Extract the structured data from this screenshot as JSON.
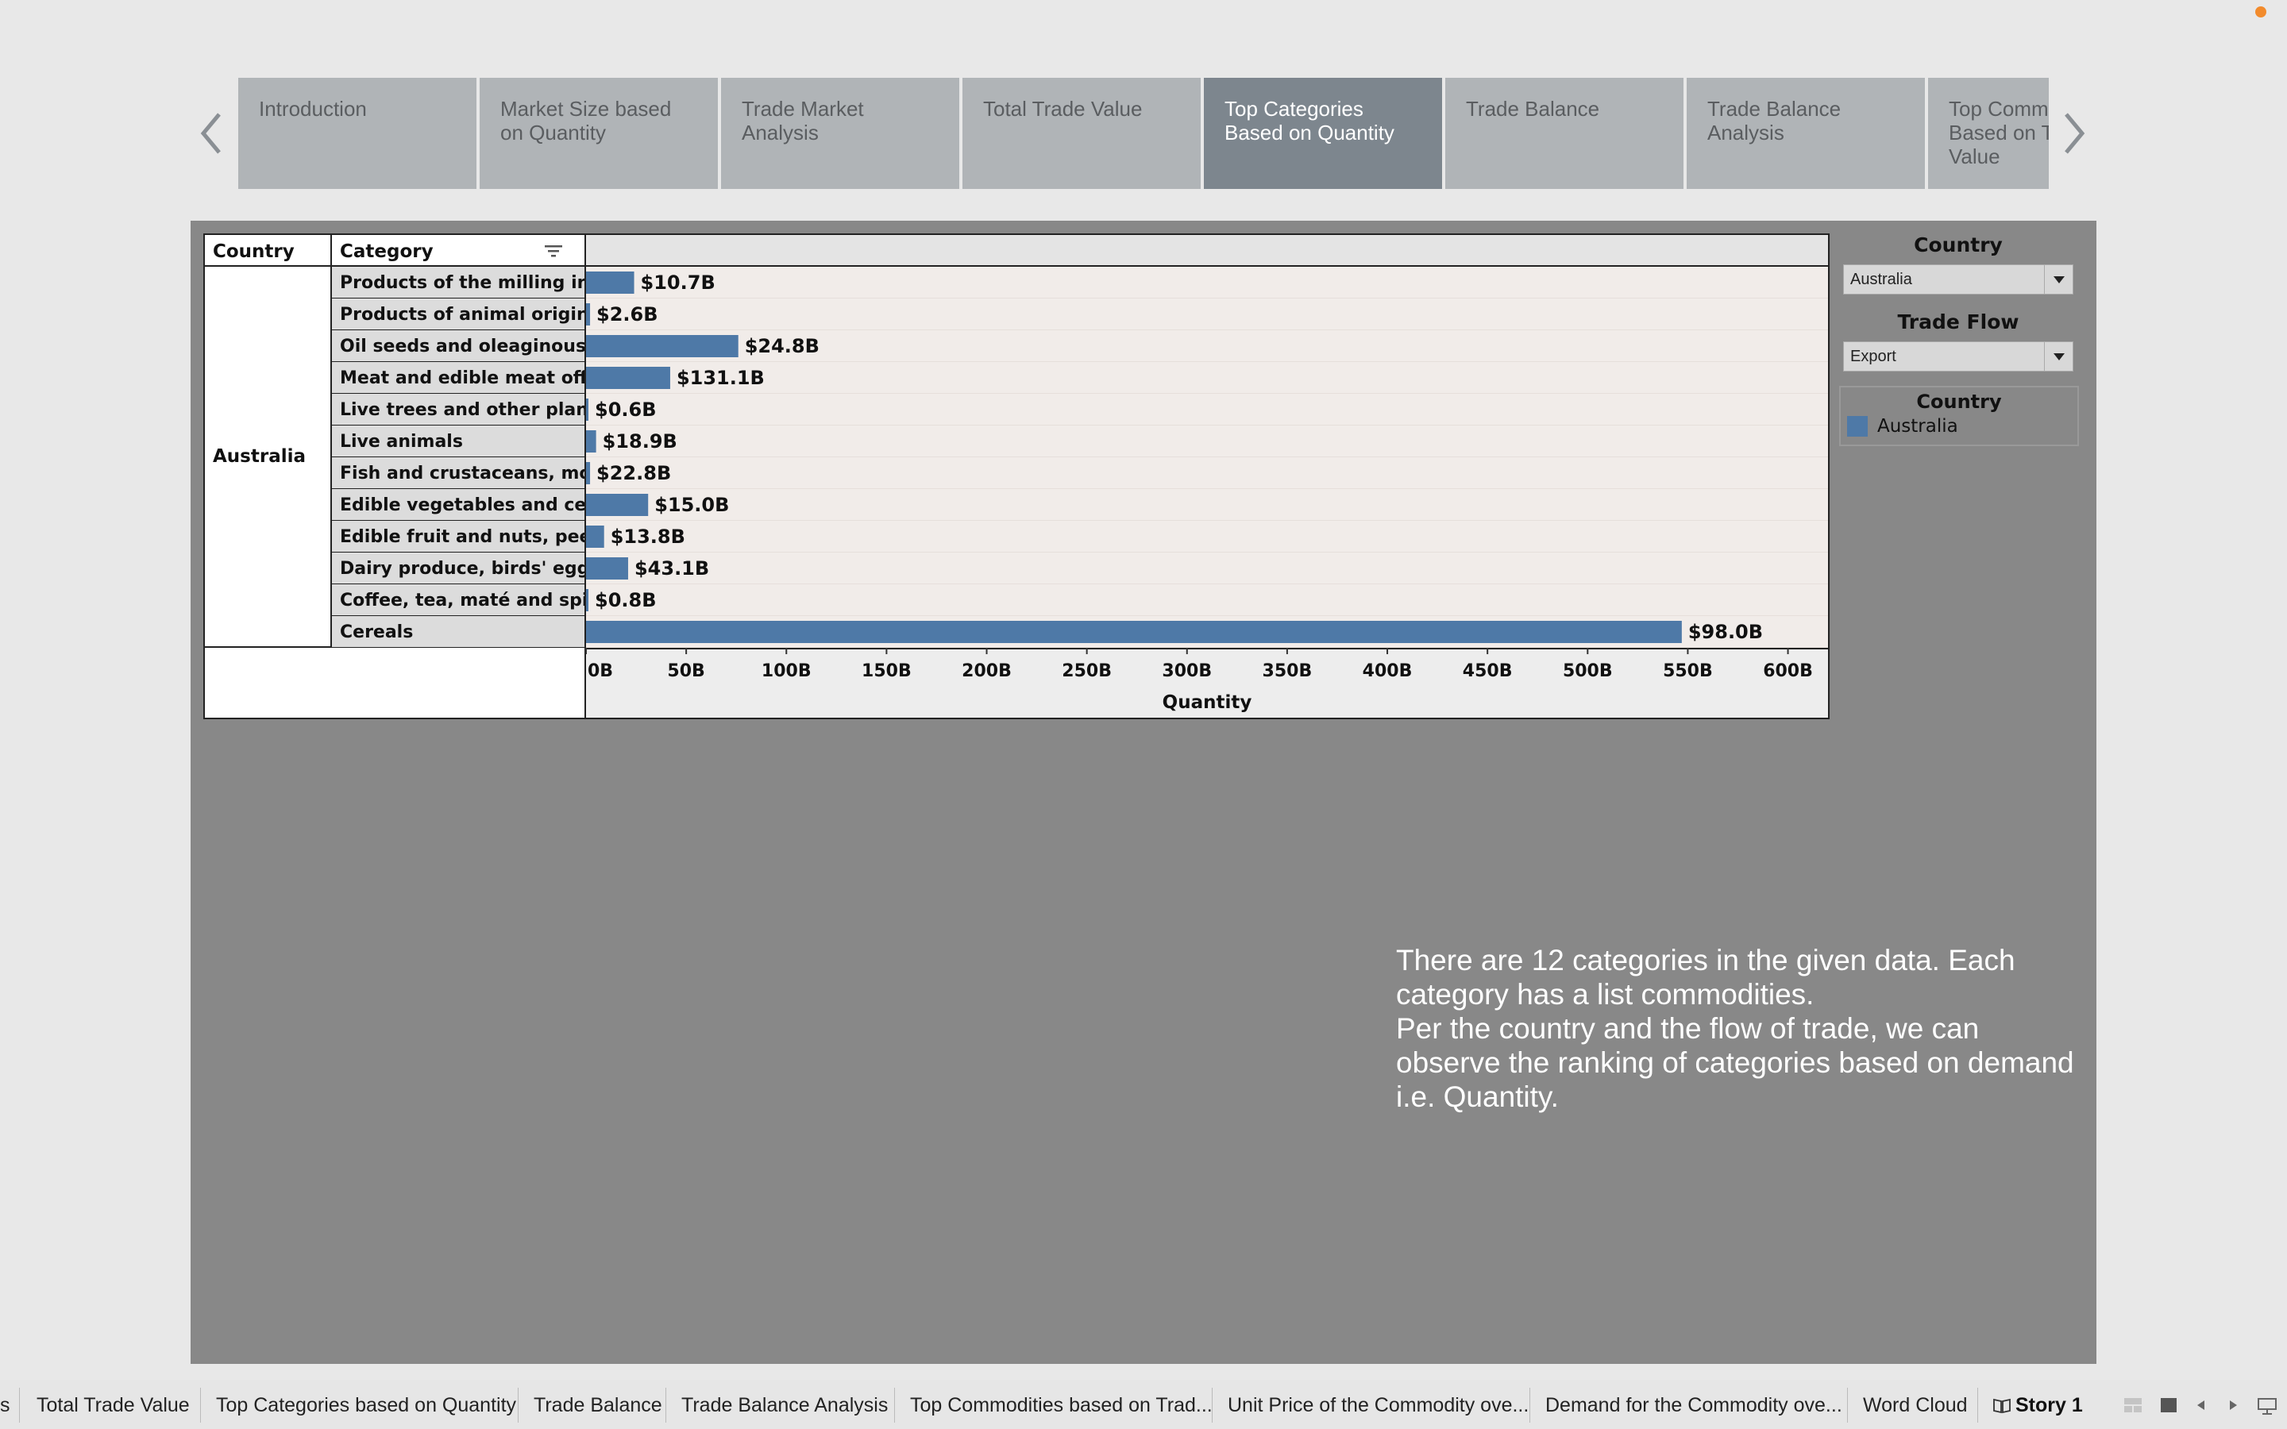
{
  "story_points": [
    {
      "label": "Introduction"
    },
    {
      "label": "Market Size based on Quantity"
    },
    {
      "label": "Trade Market Analysis"
    },
    {
      "label": "Total Trade Value"
    },
    {
      "label": "Top Categories Based on Quantity"
    },
    {
      "label": "Trade Balance"
    },
    {
      "label": "Trade Balance Analysis"
    },
    {
      "label": "Top Commodities Based on Trade Value"
    }
  ],
  "worksheet": {
    "country_header": "Country",
    "category_header": "Category",
    "country_value": "Australia"
  },
  "chart_data": {
    "type": "bar",
    "orientation": "horizontal",
    "categories": [
      "Products of the milling in..",
      "Products of animal origin,..",
      "Oil seeds and oleaginous f..",
      "Meat and edible meat offal",
      "Live trees and other plant..",
      "Live animals",
      "Fish and crustaceans, mol..",
      "Edible vegetables and cer..",
      "Edible fruit and nuts, peel..",
      "Dairy produce, birds' eggs..",
      "Coffee, tea, maté and spic..",
      "Cereals"
    ],
    "values": [
      24,
      2,
      76,
      42,
      1,
      5,
      2,
      31,
      9,
      21,
      1,
      547
    ],
    "labels": [
      "$10.7B",
      "$2.6B",
      "$24.8B",
      "$131.1B",
      "$0.6B",
      "$18.9B",
      "$22.8B",
      "$15.0B",
      "$13.8B",
      "$43.1B",
      "$0.8B",
      "$98.0B"
    ],
    "xlabel": "Quantity",
    "ylabel": "",
    "xlim": [
      0,
      620
    ],
    "ticks": [
      0,
      50,
      100,
      150,
      200,
      250,
      300,
      350,
      400,
      450,
      500,
      550,
      600
    ],
    "tick_labels": [
      "0B",
      "50B",
      "100B",
      "150B",
      "200B",
      "250B",
      "300B",
      "350B",
      "400B",
      "450B",
      "500B",
      "550B",
      "600B"
    ],
    "series": [
      {
        "name": "Australia",
        "color": "#4e79a7"
      }
    ],
    "grid": false
  },
  "filters": {
    "country_title": "Country",
    "country_value": "Australia",
    "trade_flow_title": "Trade Flow",
    "trade_flow_value": "Export"
  },
  "legend": {
    "title": "Country",
    "item": "Australia",
    "color": "#4e79a7"
  },
  "annotation": {
    "line1": "There are 12 categories in the given data. Each category has a list commodities.",
    "line2": "Per the country and the flow of trade, we can observe the ranking of categories based on demand i.e. Quantity."
  },
  "tabs": [
    {
      "label": "s"
    },
    {
      "label": "Total Trade Value"
    },
    {
      "label": "Top Categories based on Quantity"
    },
    {
      "label": "Trade Balance"
    },
    {
      "label": "Trade Balance Analysis"
    },
    {
      "label": "Top Commodities based on Trad..."
    },
    {
      "label": "Unit Price of the Commodity ove..."
    },
    {
      "label": "Demand for the Commodity ove..."
    },
    {
      "label": "Word Cloud"
    },
    {
      "label": "Story 1"
    }
  ],
  "colors": {
    "bar": "#4e79a7",
    "active_story": "#7d868e",
    "story_point": "#b0b4b7",
    "dashboard_bg": "#888888"
  }
}
